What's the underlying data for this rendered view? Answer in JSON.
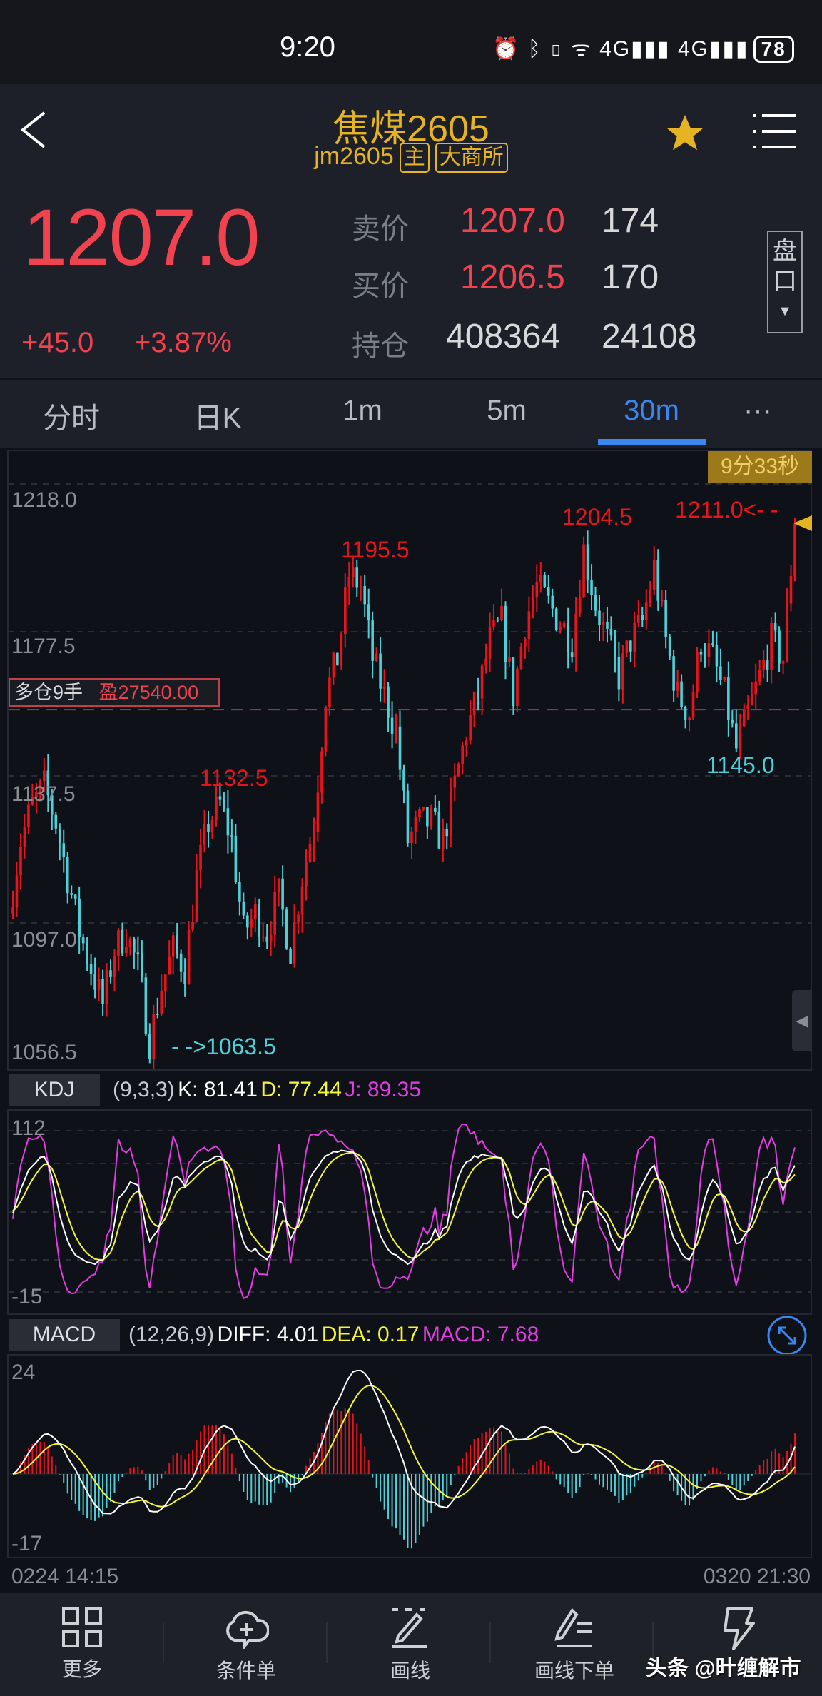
{
  "status_bar": {
    "time": "9:20",
    "battery": "78",
    "network": "4G"
  },
  "header": {
    "title": "焦煤2605",
    "code": "jm2605",
    "badge_main": "主",
    "badge_exchange": "大商所"
  },
  "quote": {
    "last": "1207.0",
    "change": "+45.0",
    "change_pct": "+3.87%",
    "ask_label": "卖价",
    "ask": "1207.0",
    "ask_vol": "174",
    "bid_label": "买价",
    "bid": "1206.5",
    "bid_vol": "170",
    "oi_label": "持仓",
    "oi": "408364",
    "oi_change": "24108",
    "pankou_label_1": "盘",
    "pankou_label_2": "口"
  },
  "tabs": [
    {
      "label": "分时"
    },
    {
      "label": "日K"
    },
    {
      "label": "1m"
    },
    {
      "label": "5m"
    },
    {
      "label": "30m"
    },
    {
      "label": "···"
    }
  ],
  "active_tab": "30m",
  "main_chart": {
    "countdown": "9分33秒",
    "position_label": "多仓9手",
    "position_pnl": "盈27540.00",
    "annotations": {
      "high1": "1195.5",
      "high2": "1204.5",
      "last_high": "1211.0<- -",
      "peak_left": "1132.5",
      "low_right": "1145.0",
      "low": "- ->1063.5"
    }
  },
  "kdj": {
    "name": "KDJ",
    "params": "(9,3,3)",
    "k": "K: 81.41",
    "d": "D: 77.44",
    "j": "J: 89.35",
    "axis_top": "112",
    "axis_bottom": "-15"
  },
  "macd": {
    "name": "MACD",
    "params": "(12,26,9)",
    "diff": "DIFF: 4.01",
    "dea": "DEA: 0.17",
    "macd": "MACD: 7.68",
    "axis_top": "24",
    "axis_bottom": "-17"
  },
  "dates": {
    "start": "0224 14:15",
    "end": "0320 21:30"
  },
  "nav": [
    {
      "label": "更多",
      "icon": "grid-icon"
    },
    {
      "label": "条件单",
      "icon": "cloud-plus-icon"
    },
    {
      "label": "画线",
      "icon": "pen-icon"
    },
    {
      "label": "画线下单",
      "icon": "pen-order-icon"
    },
    {
      "label": "",
      "icon": "lightning-icon"
    }
  ],
  "watermark": "头条 @旪缠解市",
  "colors": {
    "up": "#e8141b",
    "down": "#4fd0d8",
    "accent": "#e6b422",
    "active": "#3b86ef",
    "k": "#ffffff",
    "d": "#f5f53a",
    "j": "#e23de2"
  },
  "chart_data": {
    "type": "candlestick",
    "title": "焦煤2605 30m",
    "y_ticks": [
      "1218.0",
      "1177.5",
      "1137.5",
      "1097.0",
      "1056.5"
    ],
    "ylim": [
      1056.5,
      1218.0
    ],
    "close_anchors": [
      1100,
      1120,
      1130,
      1135,
      1125,
      1110,
      1095,
      1085,
      1075,
      1090,
      1095,
      1085,
      1065,
      1080,
      1090,
      1085,
      1110,
      1125,
      1130,
      1120,
      1095,
      1100,
      1095,
      1105,
      1090,
      1110,
      1125,
      1160,
      1170,
      1193,
      1190,
      1170,
      1160,
      1150,
      1120,
      1125,
      1125,
      1120,
      1135,
      1150,
      1160,
      1175,
      1180,
      1160,
      1180,
      1190,
      1185,
      1180,
      1175,
      1200,
      1185,
      1175,
      1165,
      1175,
      1180,
      1195,
      1175,
      1160,
      1155,
      1175,
      1170,
      1160,
      1145,
      1155,
      1165,
      1175,
      1170,
      1207
    ],
    "position_price": 1156
  }
}
